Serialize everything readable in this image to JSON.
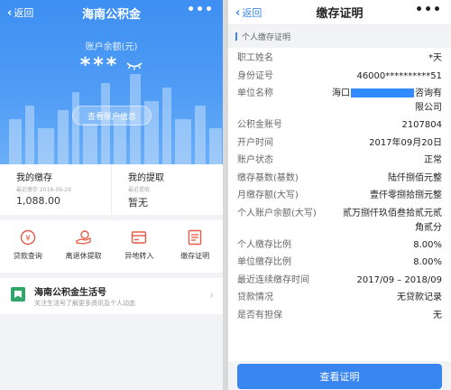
{
  "left": {
    "nav": {
      "back_label": "返回",
      "title": "海南公积金",
      "more": "•••"
    },
    "hero": {
      "balance_label": "账户余额(元)",
      "balance_masked": "***",
      "view_button": "查看账户信息"
    },
    "stats": [
      {
        "title": "我的缴存",
        "sub": "最近缴存 2018-09-29",
        "value": "1,088.00"
      },
      {
        "title": "我的提取",
        "sub": "最近提取",
        "value": "暂无"
      }
    ],
    "actions": [
      {
        "label": "贷款查询",
        "icon": "loan-coin-icon"
      },
      {
        "label": "离退休提取",
        "icon": "hand-money-icon"
      },
      {
        "label": "异地转入",
        "icon": "card-transfer-icon"
      },
      {
        "label": "缴存证明",
        "icon": "certificate-icon"
      }
    ],
    "life": {
      "title": "海南公积金生活号",
      "desc": "关注生活号了解更多资讯及个人动态"
    }
  },
  "right": {
    "nav": {
      "back_label": "返回",
      "title": "缴存证明",
      "more": "•••"
    },
    "section_title": "个人缴存证明",
    "rows": [
      {
        "k": "职工姓名",
        "v": "*天"
      },
      {
        "k": "身份证号",
        "v": "46000**********51"
      },
      {
        "k": "单位名称",
        "v_pre": "海口",
        "v_post": "咨询有限公司",
        "redacted": true
      },
      {
        "k": "公积金账号",
        "v": "2107804"
      },
      {
        "k": "开户时间",
        "v": "2017年09月20日"
      },
      {
        "k": "账户状态",
        "v": "正常"
      },
      {
        "k": "缴存基数(基数)",
        "v": "陆仟捌佰元整"
      },
      {
        "k": "月缴存额(大写)",
        "v": "壹仟零捌拾捌元整"
      },
      {
        "k": "个人账户余额(大写)",
        "v": "贰万捌仟玖佰叁拾贰元贰角贰分"
      },
      {
        "k": "个人缴存比例",
        "v": "8.00%"
      },
      {
        "k": "单位缴存比例",
        "v": "8.00%"
      },
      {
        "k": "最近连续缴存时间",
        "v": "2017/09 – 2018/09"
      },
      {
        "k": "贷款情况",
        "v": "无贷款记录"
      },
      {
        "k": "是否有担保",
        "v": "无"
      }
    ],
    "cta": "查看证明"
  },
  "colors": {
    "brand_blue": "#3a86f0",
    "hero_top": "#3d8ff2",
    "background": "#f2f3f5"
  }
}
